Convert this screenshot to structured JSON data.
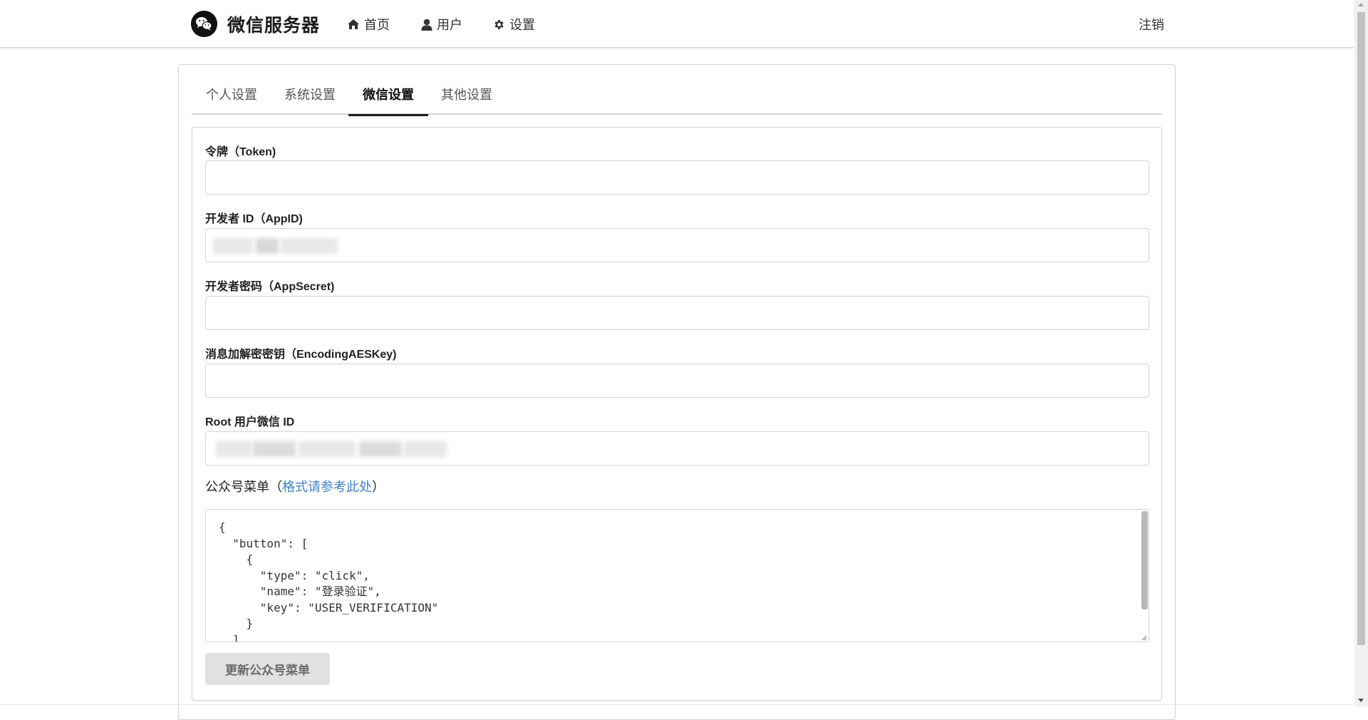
{
  "header": {
    "brand_title": "微信服务器",
    "nav": [
      {
        "label": "首页",
        "icon": "home-icon"
      },
      {
        "label": "用户",
        "icon": "user-icon"
      },
      {
        "label": "设置",
        "icon": "gear-icon"
      }
    ],
    "logout_label": "注销"
  },
  "tabs": [
    {
      "label": "个人设置",
      "active": false
    },
    {
      "label": "系统设置",
      "active": false
    },
    {
      "label": "微信设置",
      "active": true
    },
    {
      "label": "其他设置",
      "active": false
    }
  ],
  "form": {
    "token": {
      "label": "令牌（Token)",
      "value": ""
    },
    "app_id": {
      "label": "开发者 ID（AppID)",
      "value": ""
    },
    "app_secret": {
      "label": "开发者密码（AppSecret)",
      "value": ""
    },
    "aes_key": {
      "label": "消息加解密密钥（EncodingAESKey)",
      "value": ""
    },
    "root_user": {
      "label": "Root 用户微信 ID",
      "value": ""
    },
    "menu": {
      "label_prefix": "公众号菜单（",
      "link_text": "格式请参考此处",
      "label_suffix": "）",
      "content": "{\n  \"button\": [\n    {\n      \"type\": \"click\",\n      \"name\": \"登录验证\",\n      \"key\": \"USER_VERIFICATION\"\n    }\n  ]"
    },
    "update_button": "更新公众号菜单"
  },
  "colors": {
    "link": "#4183c4",
    "active_tab": "#1b1c1d",
    "button_bg": "#e0e1e2"
  }
}
